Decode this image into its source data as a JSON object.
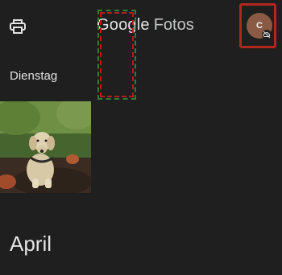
{
  "header": {
    "brand_google": "Google",
    "brand_fotos": "Fotos",
    "print_icon": "print-icon",
    "avatar_letter": "C",
    "avatar_badge_icon": "cloud-off-icon"
  },
  "timeline": {
    "day_label": "Dienstag",
    "month_label": "April"
  },
  "colors": {
    "background": "#1f1f1f",
    "avatar_bg": "#8a5a44",
    "highlight_red": "#b3261e",
    "highlight_green": "#2e7d32"
  }
}
